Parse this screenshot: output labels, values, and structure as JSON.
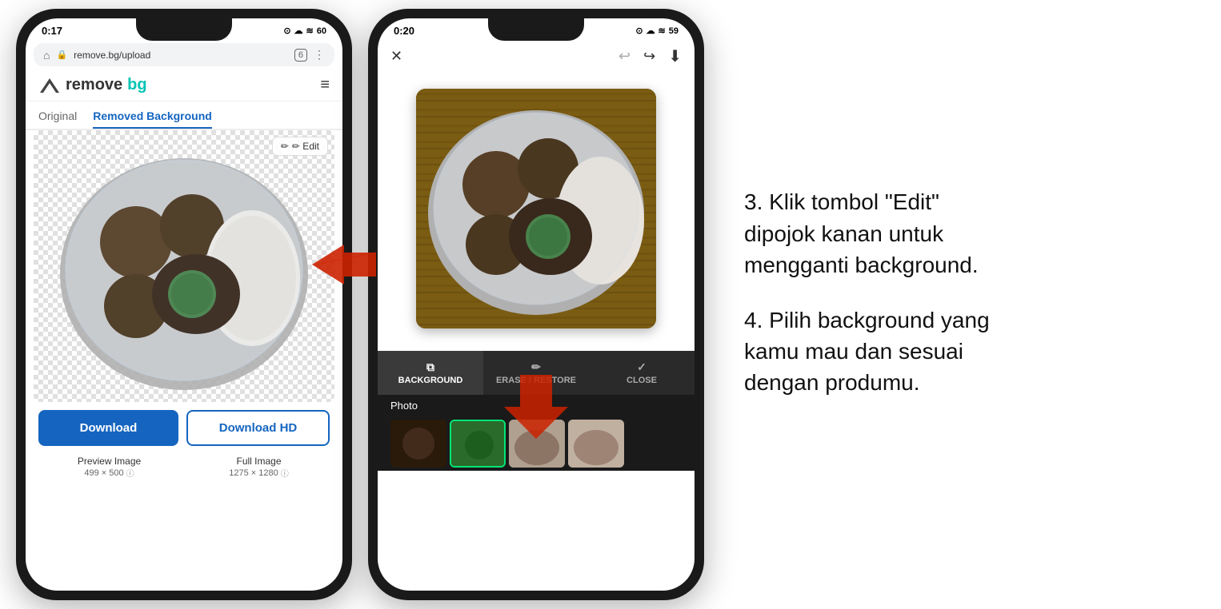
{
  "phone1": {
    "status_bar": {
      "time": "0:17",
      "icons": "◉ ☁ ⊙ ≋ 60"
    },
    "browser": {
      "url": "remove.bg/upload",
      "tab_count": "6",
      "more_icon": "⋮",
      "home_icon": "⌂",
      "lock_icon": "🔒"
    },
    "logo": {
      "remove": "remove",
      "bg": "bg"
    },
    "tabs": [
      {
        "label": "Original",
        "active": false
      },
      {
        "label": "Removed Background",
        "active": true
      }
    ],
    "edit_button": "✏ Edit",
    "buttons": {
      "download": "Download",
      "download_hd": "Download HD"
    },
    "image_info": {
      "preview": {
        "label": "Preview Image",
        "size": "499 × 500"
      },
      "full": {
        "label": "Full Image",
        "size": "1275 × 1280"
      }
    }
  },
  "phone2": {
    "status_bar": {
      "time": "0:20",
      "icons": "◉ ☁ ⊙ ≋ 59"
    },
    "toolbar": {
      "background": "BACKGROUND",
      "erase_restore": "ERASE / RESTORE",
      "close": "CLOSE"
    },
    "photo_label": "Photo",
    "thumbnails": [
      {
        "type": "dark",
        "id": 1
      },
      {
        "type": "green",
        "id": 2
      },
      {
        "type": "food",
        "id": 3
      },
      {
        "type": "food2",
        "id": 4
      }
    ]
  },
  "instructions": {
    "step3": "3. Klik  tombol \"Edit\" dipojok kanan untuk mengganti background.",
    "step4": "4. Pilih background yang kamu mau dan sesuai dengan produmu."
  }
}
